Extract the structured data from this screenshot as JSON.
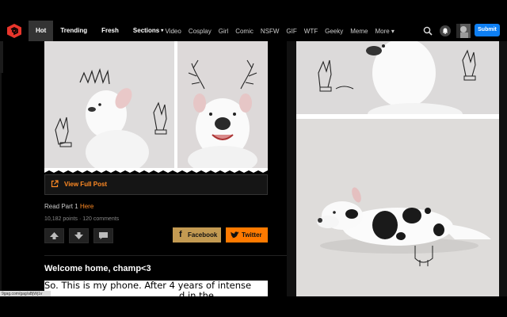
{
  "nav": {
    "main": [
      "Hot",
      "Trending",
      "Fresh",
      "Sections"
    ],
    "sections_chevron": "▾",
    "links": [
      "Video",
      "Cosplay",
      "Girl",
      "Comic",
      "NSFW",
      "GIF",
      "WTF",
      "Geeky",
      "Meme",
      "More ▾"
    ],
    "submit": "Submit"
  },
  "post": {
    "view_full": "View Full Post",
    "read_part": "Read Part 1",
    "read_part_link": "Here",
    "meta": "10,182 points · 120 comments",
    "share_facebook": "Facebook",
    "share_twitter": "Twitter",
    "title": "Welcome home, champ<3",
    "text_line1": "So. This is my phone. After 4 years of intense",
    "text_line2": "d in the Northlands."
  },
  "status_url": "9gag.com/gag/aBjWj1v",
  "colors": {
    "accent": "#ff8a24",
    "submit": "#0e7ff3",
    "facebook": "#c39a52",
    "twitter": "#ff7a00"
  }
}
